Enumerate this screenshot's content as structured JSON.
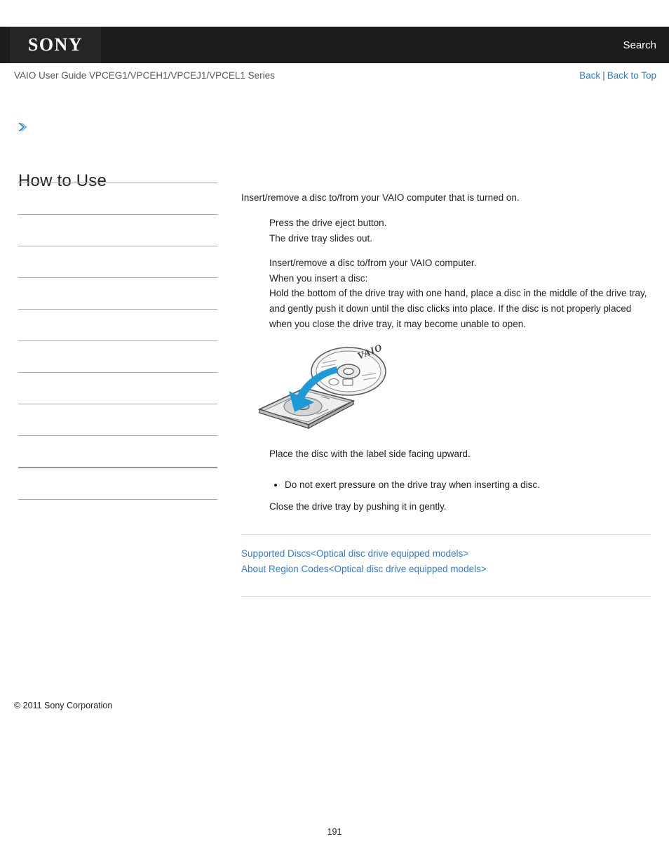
{
  "header": {
    "logo_text": "SONY",
    "search_label": "Search",
    "guide_title": "VAIO User Guide VPCEG1/VPCEH1/VPCEJ1/VPCEL1 Series",
    "back_label": "Back",
    "separator": "|",
    "back_to_top_label": "Back to Top",
    "accent_color": "#2a7fd4",
    "bar_color": "#1c1c1c"
  },
  "sidebar": {
    "expand_icon": "chevron-double-right-icon",
    "title": "How to Use",
    "items": [
      {
        "label": ""
      },
      {
        "label": ""
      },
      {
        "label": ""
      },
      {
        "label": ""
      },
      {
        "label": ""
      },
      {
        "label": ""
      },
      {
        "label": ""
      },
      {
        "label": ""
      },
      {
        "label": ""
      },
      {
        "label": ""
      }
    ],
    "copyright": "© 2011 Sony Corporation"
  },
  "main": {
    "intro": "Insert/remove a disc to/from your VAIO computer that is turned on.",
    "steps": [
      {
        "lines": [
          "Press the drive eject button.",
          "The drive tray slides out."
        ]
      },
      {
        "lines": [
          "Insert/remove a disc to/from your VAIO computer.",
          "When you insert a disc:",
          "Hold the bottom of the drive tray with one hand, place a disc in the middle of the drive tray, and gently push it down until the disc clicks into place. If the disc is not properly placed when you close the drive tray, it may become unable to open."
        ]
      }
    ],
    "figure": {
      "name": "disc-insertion-illustration",
      "disc_label": "VAIO",
      "arrow_color": "#1b9ad6"
    },
    "caption": "Place the disc with the label side facing upward.",
    "notes": [
      "Do not exert pressure on the drive tray when inserting a disc."
    ],
    "closing": "Close the drive tray by pushing it in gently.",
    "related_links": [
      "Supported Discs<Optical disc drive equipped models>",
      "About Region Codes<Optical disc drive equipped models>"
    ]
  },
  "footer": {
    "page_number": "191"
  }
}
